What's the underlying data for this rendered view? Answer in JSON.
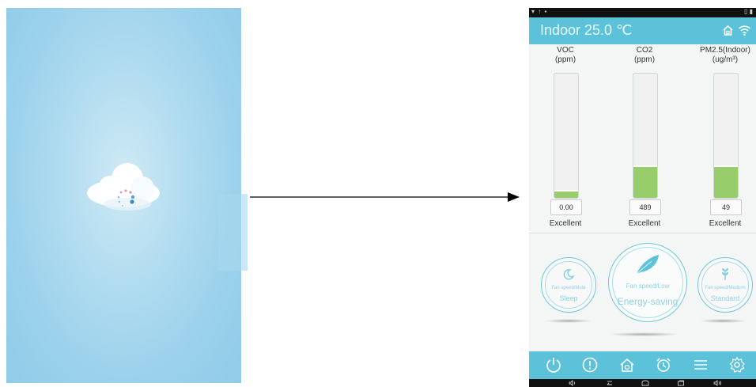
{
  "phone": {
    "status_left": "▾ ↑ ▪",
    "status_right": "▯ ▮",
    "header": {
      "title": "Indoor 25.0 ℃"
    },
    "meters": [
      {
        "label": "VOC",
        "unit": "(ppm)",
        "value": "0.00",
        "rating": "Excellent",
        "level": 0.05
      },
      {
        "label": "CO2",
        "unit": "(ppm)",
        "value": "489",
        "rating": "Excellent",
        "level": 0.25
      },
      {
        "label": "PM2.5(Indoor)",
        "unit": "(ug/m³)",
        "value": "49",
        "rating": "Excellent",
        "level": 0.25
      }
    ],
    "modes": {
      "sleep": {
        "speed": "Fan speed/Mute",
        "name": "Sleep"
      },
      "energy": {
        "speed": "Fan speed/Low",
        "name": "Energy-saving"
      },
      "standard": {
        "speed": "Fan speed/Medium",
        "name": "Standard"
      }
    },
    "bottom_icons": [
      "power-icon",
      "alert-icon",
      "home-icon",
      "alarm-clock-icon",
      "menu-icon",
      "settings-icon"
    ],
    "nav_icons": [
      "volume-down-icon",
      "back-icon",
      "home-icon",
      "recents-icon",
      "volume-up-icon"
    ]
  },
  "colors": {
    "accent": "#5cc2d9",
    "bar_fill": "#98cd6b",
    "splash": "#9bd1ec"
  }
}
